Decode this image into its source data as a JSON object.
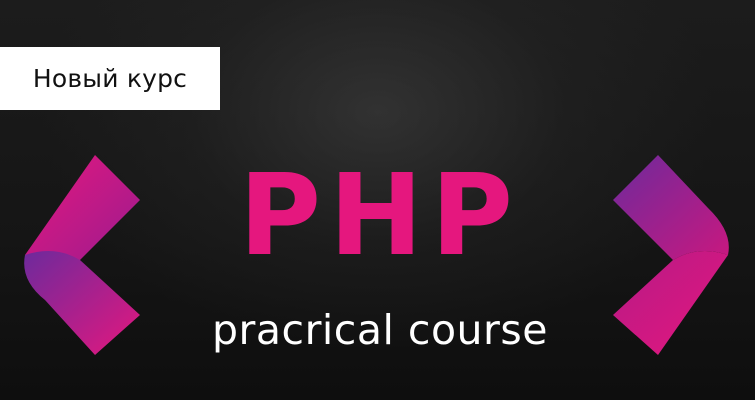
{
  "badge": {
    "label": "Новый курс"
  },
  "title": "PHP",
  "subtitle": "pracrical course",
  "colors": {
    "accent": "#e5177e",
    "accent_dark": "#6d2a9c",
    "badge_bg": "#ffffff",
    "background": "#161616",
    "text_light": "#ffffff"
  },
  "icons": {
    "left": "left-angle-bracket-icon",
    "right": "right-angle-bracket-icon"
  }
}
